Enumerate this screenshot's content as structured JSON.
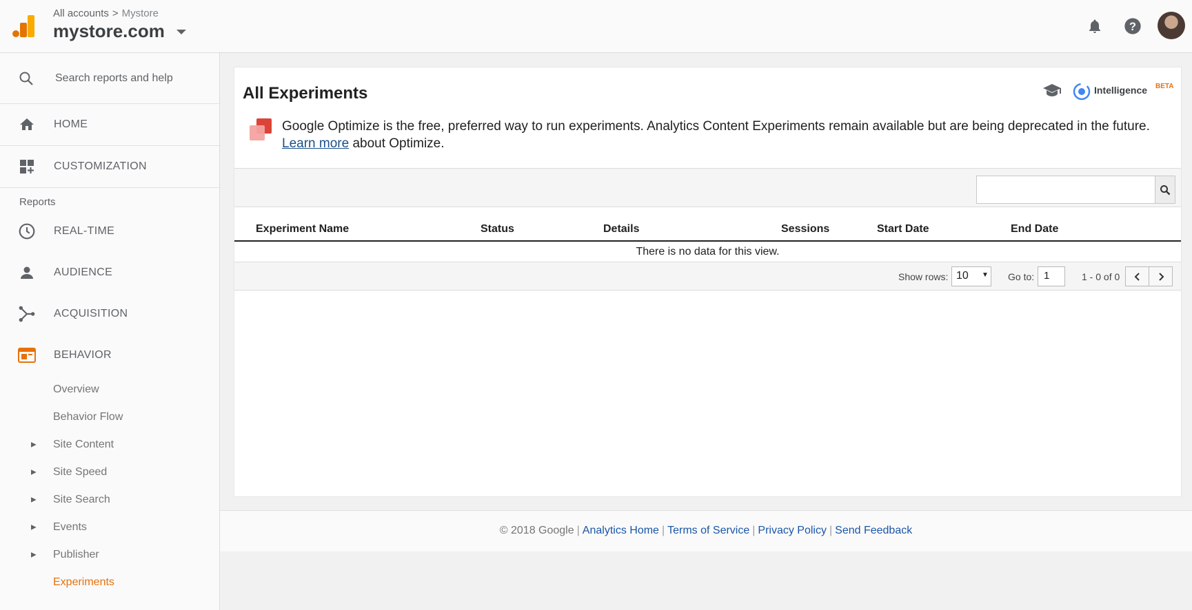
{
  "header": {
    "crumb_root": "All accounts",
    "crumb_sep": ">",
    "crumb_property": "Mystore",
    "account_name": "mystore.com",
    "icons": [
      "bell-icon",
      "help-icon"
    ]
  },
  "sidebar": {
    "search_placeholder": "Search reports and help",
    "home": "HOME",
    "customization": "CUSTOMIZATION",
    "reports_label": "Reports",
    "nav": [
      {
        "label": "REAL-TIME",
        "icon": "clock-icon"
      },
      {
        "label": "AUDIENCE",
        "icon": "person-icon"
      },
      {
        "label": "ACQUISITION",
        "icon": "acquisition-icon"
      },
      {
        "label": "BEHAVIOR",
        "icon": "behavior-icon",
        "active": true
      }
    ],
    "behavior_items": [
      {
        "label": "Overview",
        "expandable": false
      },
      {
        "label": "Behavior Flow",
        "expandable": false
      },
      {
        "label": "Site Content",
        "expandable": true
      },
      {
        "label": "Site Speed",
        "expandable": true
      },
      {
        "label": "Site Search",
        "expandable": true
      },
      {
        "label": "Events",
        "expandable": true
      },
      {
        "label": "Publisher",
        "expandable": true
      },
      {
        "label": "Experiments",
        "expandable": false,
        "active": true
      }
    ],
    "accent_color": "#e8710a"
  },
  "main": {
    "title": "All Experiments",
    "intelligence_label": "Intelligence",
    "beta_label": "BETA",
    "notice_text": "Google Optimize is the free, preferred way to run experiments. Analytics Content Experiments remain available but are being deprecated in the future. ",
    "notice_link": "Learn more",
    "notice_tail": " about Optimize.",
    "search_value": "",
    "columns": [
      "Experiment Name",
      "Status",
      "Details",
      "Sessions",
      "Start Date",
      "End Date"
    ],
    "empty_text": "There is no data for this view.",
    "pager": {
      "show_rows_label": "Show rows:",
      "rows_value": "10",
      "goto_label": "Go to:",
      "goto_value": "1",
      "range_text": "1 - 0 of 0"
    }
  },
  "footer": {
    "copyright": "© 2018 Google",
    "links": [
      "Analytics Home",
      "Terms of Service",
      "Privacy Policy",
      "Send Feedback"
    ],
    "link_color": "#1a56a8"
  }
}
